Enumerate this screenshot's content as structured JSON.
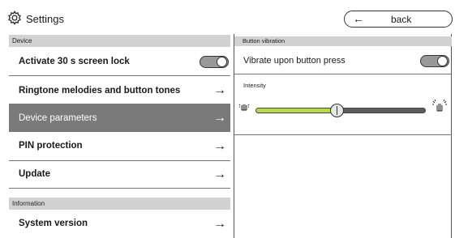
{
  "header": {
    "title": "Settings",
    "icon": "gear-icon",
    "back_label": "back",
    "back_arrow": "←"
  },
  "left": {
    "sections": [
      {
        "label": "Device"
      },
      {
        "label": "Information"
      }
    ],
    "rows": [
      {
        "label": "Activate 30 s screen lock",
        "control": "toggle",
        "toggle_on": false
      },
      {
        "label": "Ringtone melodies and button tones",
        "control": "arrow"
      },
      {
        "label": "Device parameters",
        "control": "arrow",
        "selected": true
      },
      {
        "label": "PIN protection",
        "control": "arrow"
      },
      {
        "label": "Update",
        "control": "arrow"
      },
      {
        "label": "System version",
        "control": "arrow"
      }
    ],
    "arrow_glyph": "→"
  },
  "right": {
    "section": "Button vibration",
    "vibrate_label": "Vibrate upon button press",
    "vibrate_on": false,
    "intensity_label": "Intensity",
    "intensity_value": 0.48,
    "fill_color": "#b7d84b",
    "min_icon": "weak-vibration-hand-icon",
    "max_icon": "strong-vibration-hand-icon"
  },
  "colors": {
    "selected_row": "#7a7a7a",
    "section_bg": "#d2d2d2"
  }
}
